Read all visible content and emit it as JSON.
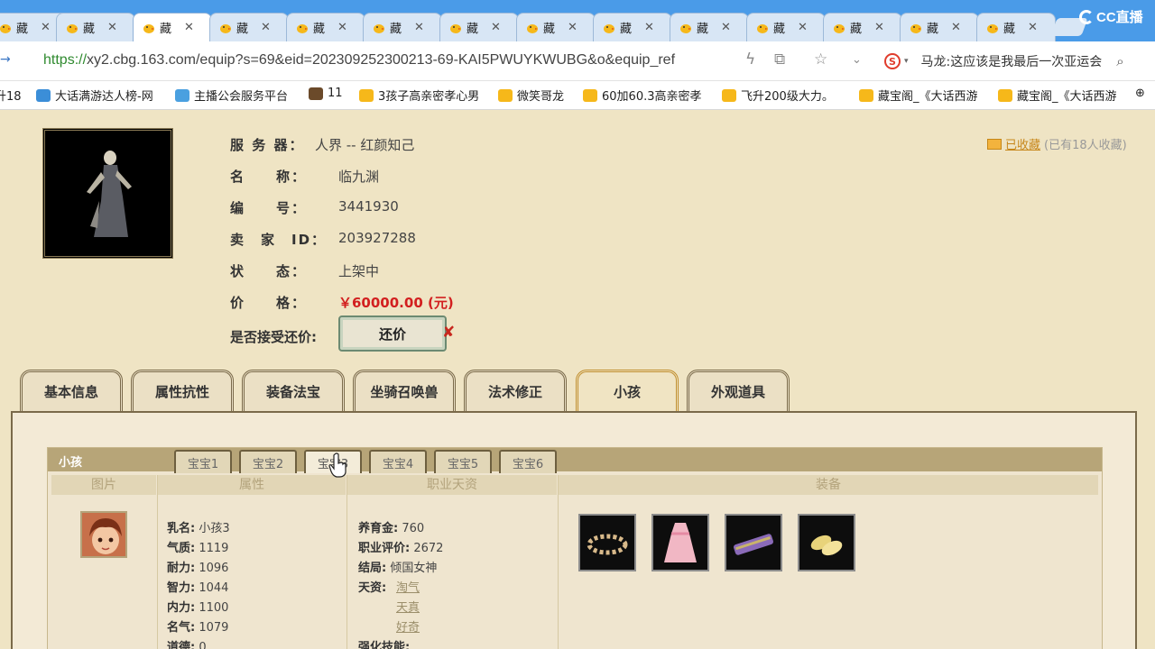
{
  "browser": {
    "tabs": [
      {
        "title": "藏"
      },
      {
        "title": "藏"
      },
      {
        "title": "藏",
        "active": true
      },
      {
        "title": "藏"
      },
      {
        "title": "藏"
      },
      {
        "title": "藏"
      },
      {
        "title": "藏"
      },
      {
        "title": "藏"
      },
      {
        "title": "藏"
      },
      {
        "title": "藏"
      },
      {
        "title": "藏"
      },
      {
        "title": "藏"
      },
      {
        "title": "藏"
      },
      {
        "title": "藏"
      }
    ],
    "close_glyph": "✕",
    "brand": "CC直播",
    "url_scheme": "https://",
    "url_rest": "xy2.cbg.163.com/equip?s=69&eid=202309252300213-69-KAI5PWUYKWUBG&o&equip_ref",
    "search_text": "马龙:这应该是我最后一次亚运会",
    "bookmarks": [
      {
        "label": "升18"
      },
      {
        "label": "大话满游达人榜-网"
      },
      {
        "label": "主播公会服务平台"
      },
      {
        "label": "11"
      },
      {
        "label": "3孩子高亲密孝心男"
      },
      {
        "label": "微笑哥龙"
      },
      {
        "label": "60加60.3高亲密孝"
      },
      {
        "label": "飞升200级大力。"
      },
      {
        "label": "藏宝阁_《大话西游"
      },
      {
        "label": "藏宝阁_《大话西游"
      }
    ]
  },
  "item": {
    "server_label": "服 务 器：",
    "server_value": "人界 -- 红颜知己",
    "name_label": "名　　称：",
    "name_value": "临九渊",
    "id_label": "编　　号：",
    "id_value": "3441930",
    "seller_label": "卖　家　ID：",
    "seller_value": "203927288",
    "status_label": "状　　态：",
    "status_value": "上架中",
    "price_label": "价　　格：",
    "price_value": "￥60000.00 (元)",
    "counter_label": "是否接受还价:",
    "counter_button": "还价",
    "counter_close": "✘",
    "favorited": "已收藏",
    "fav_count": "(已有18人收藏)"
  },
  "main_tabs": [
    {
      "label": "基本信息"
    },
    {
      "label": "属性抗性"
    },
    {
      "label": "装备法宝"
    },
    {
      "label": "坐骑召唤兽"
    },
    {
      "label": "法术修正"
    },
    {
      "label": "小孩",
      "active": true
    },
    {
      "label": "外观道具"
    }
  ],
  "child_panel": {
    "title": "小孩",
    "baby_tabs": [
      {
        "label": "宝宝1"
      },
      {
        "label": "宝宝2"
      },
      {
        "label": "宝宝3",
        "active": true
      },
      {
        "label": "宝宝4"
      },
      {
        "label": "宝宝5"
      },
      {
        "label": "宝宝6"
      }
    ],
    "columns": [
      "图片",
      "属性",
      "职业天资",
      "装备"
    ],
    "attributes": [
      {
        "label": "乳名:",
        "value": "小孩3"
      },
      {
        "label": "气质:",
        "value": "1119"
      },
      {
        "label": "耐力:",
        "value": "1096"
      },
      {
        "label": "智力:",
        "value": "1044"
      },
      {
        "label": "内力:",
        "value": "1100"
      },
      {
        "label": "名气:",
        "value": "1079"
      },
      {
        "label": "道德:",
        "value": "0"
      }
    ],
    "career": {
      "fund_label": "养育金:",
      "fund_value": "760",
      "eval_label": "职业评价:",
      "eval_value": "2672",
      "ending_label": "结局:",
      "ending_value": "倾国女神",
      "talent_label": "天资:",
      "talents": [
        "淘气",
        "天真",
        "好奇"
      ],
      "skill_label": "强化技能:"
    },
    "equipment": [
      {
        "name": "flower-crown"
      },
      {
        "name": "pink-dress"
      },
      {
        "name": "bamboo-instrument"
      },
      {
        "name": "golden-shoes"
      }
    ]
  }
}
